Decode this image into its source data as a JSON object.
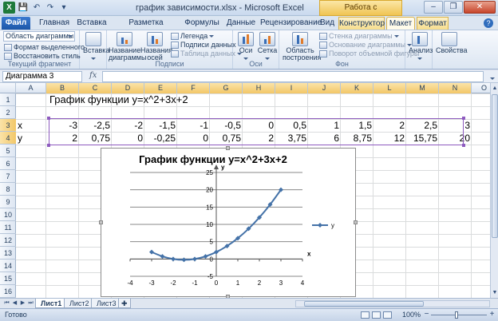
{
  "window": {
    "title": "график зависимости.xlsx  -  Microsoft Excel",
    "context_tools": "Работа с диаграммами",
    "qat_logo": "X",
    "btn_minimize": "–",
    "btn_restore": "❐",
    "btn_close": "✕"
  },
  "tabs": {
    "file": "Файл",
    "home": "Главная",
    "insert": "Вставка",
    "page_layout": "Разметка страницы",
    "formulas": "Формулы",
    "data": "Данные",
    "review": "Рецензирование",
    "view": "Вид",
    "designer": "Конструктор",
    "layout": "Макет",
    "format": "Формат",
    "help": "?"
  },
  "ribbon": {
    "current_fragment": {
      "combo": "Область диаграммы",
      "format_selection": "Формат выделенного",
      "reset_style": "Восстановить стиль",
      "label": "Текущий фрагмент"
    },
    "insert": {
      "label": "Вставка"
    },
    "labels": {
      "chart_title": "Название диаграммы",
      "axis_titles": "Названия осей",
      "legend": "Легенда",
      "data_labels": "Подписи данных",
      "data_table": "Таблица данных",
      "label": "Подписи"
    },
    "axes": {
      "axes": "Оси",
      "gridlines": "Сетка",
      "label": "Оси"
    },
    "background": {
      "plot_area": "Область построения",
      "chart_wall": "Стенка диаграммы",
      "chart_floor": "Основание диаграммы",
      "rotation": "Поворот объемной фигуры",
      "label": "Фон"
    },
    "analysis": {
      "label": "Анализ"
    },
    "properties": {
      "label": "Свойства"
    }
  },
  "formula_bar": {
    "name_box": "Диаграмма 3",
    "fx": "fx",
    "formula": ""
  },
  "columns": [
    "A",
    "B",
    "C",
    "D",
    "E",
    "F",
    "G",
    "H",
    "I",
    "J",
    "K",
    "L",
    "M",
    "N",
    "O"
  ],
  "rows": [
    "1",
    "2",
    "3",
    "4",
    "5",
    "6",
    "7",
    "8",
    "9",
    "10",
    "11",
    "12",
    "13",
    "14",
    "15",
    "16"
  ],
  "cells": {
    "title": "График функции y=x^2+3x+2",
    "x_label": "x",
    "y_label": "y",
    "x_values": [
      "-3",
      "-2,5",
      "-2",
      "-1,5",
      "-1",
      "-0,5",
      "0",
      "0,5",
      "1",
      "1,5",
      "2",
      "2,5",
      "3"
    ],
    "y_values": [
      "2",
      "0,75",
      "0",
      "-0,25",
      "0",
      "0,75",
      "2",
      "3,75",
      "6",
      "8,75",
      "12",
      "15,75",
      "20"
    ]
  },
  "chart_data": {
    "type": "line",
    "title": "График функции y=x^2+3x+2",
    "xlabel": "x",
    "ylabel": "y",
    "xlim": [
      -4,
      4
    ],
    "ylim": [
      -5,
      25
    ],
    "xticks": [
      -4,
      -3,
      -2,
      -1,
      0,
      1,
      2,
      3,
      4
    ],
    "yticks": [
      -5,
      0,
      5,
      10,
      15,
      20,
      25
    ],
    "grid": "horizontal",
    "legend": "right",
    "series": [
      {
        "name": "y",
        "color": "#4472a8",
        "x": [
          -3,
          -2.5,
          -2,
          -1.5,
          -1,
          -0.5,
          0,
          0.5,
          1,
          1.5,
          2,
          2.5,
          3
        ],
        "y": [
          2,
          0.75,
          0,
          -0.25,
          0,
          0.75,
          2,
          3.75,
          6,
          8.75,
          12,
          15.75,
          20
        ]
      }
    ]
  },
  "sheet_tabs": [
    "Лист1",
    "Лист2",
    "Лист3"
  ],
  "status": {
    "ready": "Готово",
    "zoom": "100%",
    "zoom_out": "−",
    "zoom_in": "+"
  },
  "colors": {
    "accent": "#2f6dbd",
    "selection": "#8e5bbf",
    "series": "#4472a8"
  }
}
